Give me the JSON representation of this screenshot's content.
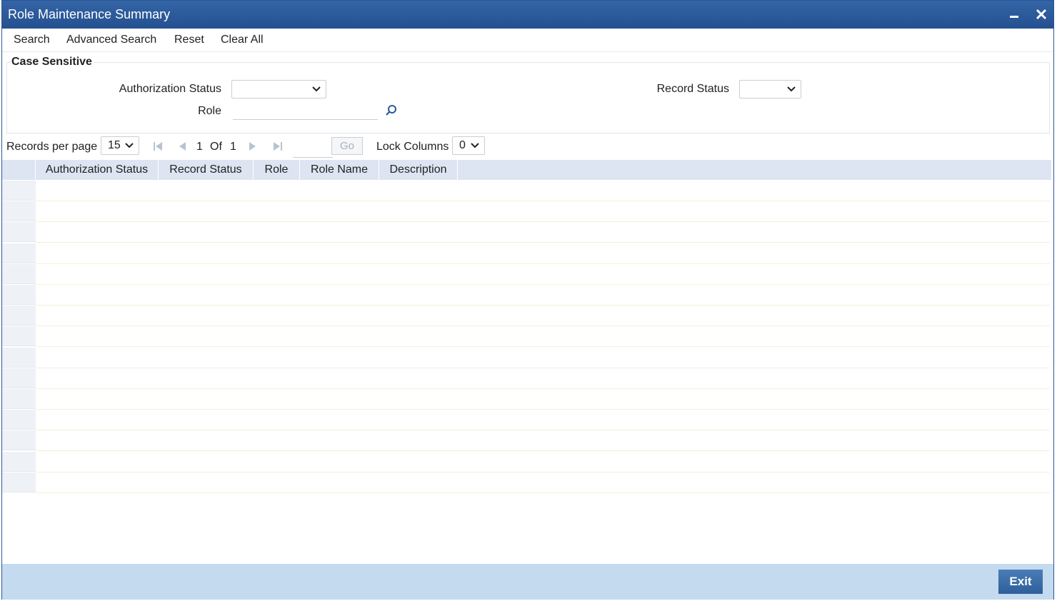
{
  "window": {
    "title": "Role Maintenance Summary",
    "minimize_icon": "minimize-icon",
    "close_icon": "close-icon"
  },
  "toolbar": {
    "search": "Search",
    "advanced_search": "Advanced Search",
    "reset": "Reset",
    "clear_all": "Clear All"
  },
  "criteria": {
    "legend": "Case Sensitive",
    "authorization_status_label": "Authorization Status",
    "authorization_status_value": "",
    "record_status_label": "Record Status",
    "record_status_value": "",
    "role_label": "Role",
    "role_value": ""
  },
  "pager": {
    "records_per_page_label": "Records per page",
    "records_per_page_value": "15",
    "current_page": "1",
    "of_label": "Of",
    "total_pages": "1",
    "go_label": "Go",
    "lock_columns_label": "Lock Columns",
    "lock_columns_value": "0"
  },
  "grid": {
    "columns": [
      "Authorization Status",
      "Record Status",
      "Role",
      "Role Name",
      "Description"
    ],
    "rows": []
  },
  "footer": {
    "exit_label": "Exit"
  },
  "colors": {
    "title_bar": "#2a5a9c",
    "grid_header": "#dde5f2",
    "footer": "#c4daee",
    "exit_button": "#3c6ea8"
  }
}
